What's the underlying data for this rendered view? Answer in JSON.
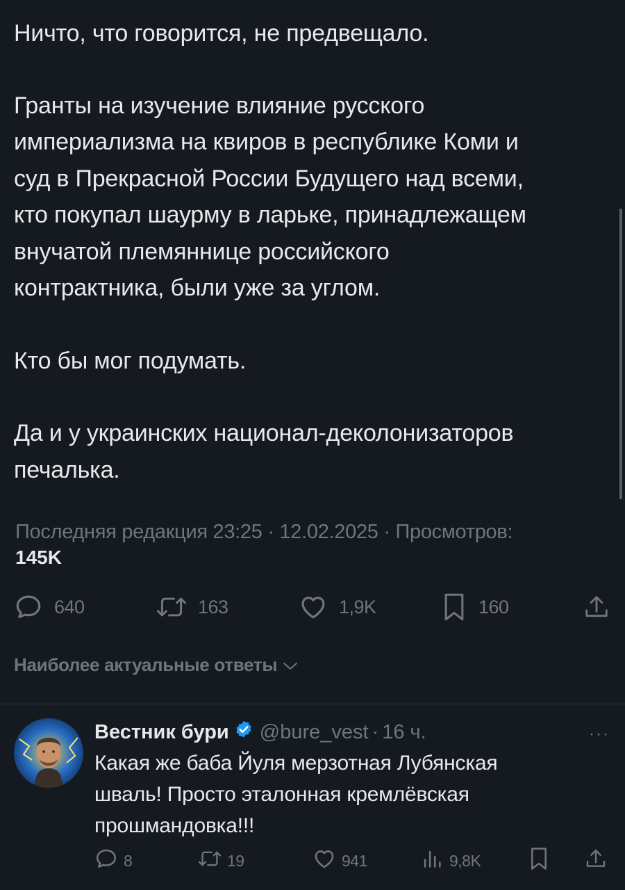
{
  "tweet": {
    "paragraphs": [
      "Ничто, что говорится, не предвещало.",
      "Гранты на изучение влияние русского\nимпериализма на квиров в республике Коми и\nсуд в Прекрасной России Будущего над всеми,\nкто покупал шаурму в ларьке, принадлежащем\nвнучатой племяннице российского\nконтрактника, были уже за углом.",
      "Кто бы мог подумать.",
      "Да и у украинских национал-деколонизаторов\nпечалька."
    ],
    "meta": {
      "edited_label": "Последняя редакция 23:25 · 12.02.2025",
      "separator": " · ",
      "views_label": "Просмотров:",
      "views_count": "145K"
    },
    "actions": {
      "replies": "640",
      "reposts": "163",
      "likes": "1,9K",
      "bookmarks": "160"
    },
    "icons": [
      "reply-icon",
      "repost-icon",
      "like-icon",
      "bookmark-icon",
      "share-icon"
    ]
  },
  "replies_sort": {
    "label": "Наиболее актуальные ответы"
  },
  "reply": {
    "name": "Вестник бури",
    "handle": "@bure_vest",
    "separator": "·",
    "time": "16 ч.",
    "more": "···",
    "text": "Какая же баба Йуля мерзотная Лубянская\nшваль! Просто эталонная кремлёвская\nпрошмандовка!!!",
    "actions": {
      "replies": "8",
      "reposts": "19",
      "likes": "941",
      "views": "9,8K"
    },
    "icons": [
      "reply-icon",
      "repost-icon",
      "like-icon",
      "views-icon",
      "bookmark-icon",
      "share-icon"
    ]
  },
  "colors": {
    "background": "#151a21",
    "text": "#e7e9ea",
    "muted": "#6e767d",
    "verified": "#1d9bf0",
    "divider": "#2f3336"
  }
}
